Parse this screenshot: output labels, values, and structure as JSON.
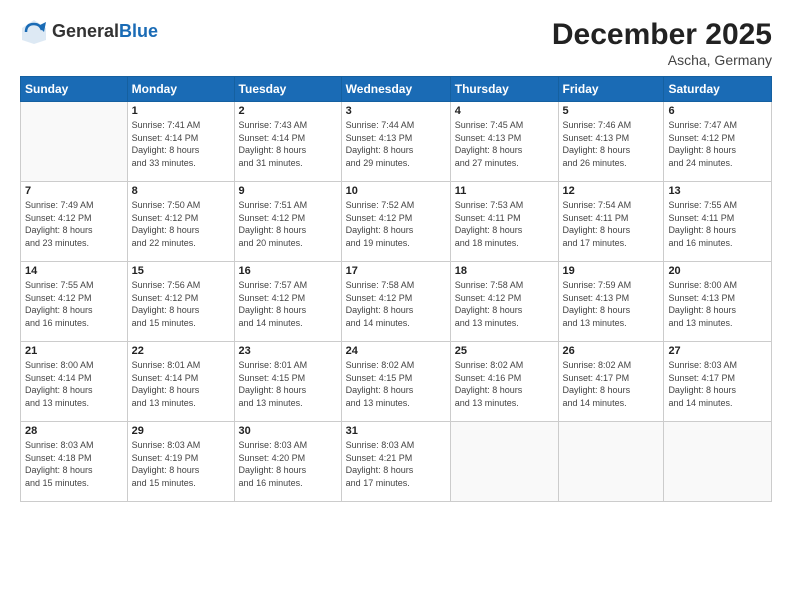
{
  "header": {
    "logo_line1": "General",
    "logo_line2": "Blue",
    "month": "December 2025",
    "location": "Ascha, Germany"
  },
  "days_of_week": [
    "Sunday",
    "Monday",
    "Tuesday",
    "Wednesday",
    "Thursday",
    "Friday",
    "Saturday"
  ],
  "weeks": [
    [
      {
        "day": "",
        "info": ""
      },
      {
        "day": "1",
        "info": "Sunrise: 7:41 AM\nSunset: 4:14 PM\nDaylight: 8 hours\nand 33 minutes."
      },
      {
        "day": "2",
        "info": "Sunrise: 7:43 AM\nSunset: 4:14 PM\nDaylight: 8 hours\nand 31 minutes."
      },
      {
        "day": "3",
        "info": "Sunrise: 7:44 AM\nSunset: 4:13 PM\nDaylight: 8 hours\nand 29 minutes."
      },
      {
        "day": "4",
        "info": "Sunrise: 7:45 AM\nSunset: 4:13 PM\nDaylight: 8 hours\nand 27 minutes."
      },
      {
        "day": "5",
        "info": "Sunrise: 7:46 AM\nSunset: 4:13 PM\nDaylight: 8 hours\nand 26 minutes."
      },
      {
        "day": "6",
        "info": "Sunrise: 7:47 AM\nSunset: 4:12 PM\nDaylight: 8 hours\nand 24 minutes."
      }
    ],
    [
      {
        "day": "7",
        "info": "Sunrise: 7:49 AM\nSunset: 4:12 PM\nDaylight: 8 hours\nand 23 minutes."
      },
      {
        "day": "8",
        "info": "Sunrise: 7:50 AM\nSunset: 4:12 PM\nDaylight: 8 hours\nand 22 minutes."
      },
      {
        "day": "9",
        "info": "Sunrise: 7:51 AM\nSunset: 4:12 PM\nDaylight: 8 hours\nand 20 minutes."
      },
      {
        "day": "10",
        "info": "Sunrise: 7:52 AM\nSunset: 4:12 PM\nDaylight: 8 hours\nand 19 minutes."
      },
      {
        "day": "11",
        "info": "Sunrise: 7:53 AM\nSunset: 4:11 PM\nDaylight: 8 hours\nand 18 minutes."
      },
      {
        "day": "12",
        "info": "Sunrise: 7:54 AM\nSunset: 4:11 PM\nDaylight: 8 hours\nand 17 minutes."
      },
      {
        "day": "13",
        "info": "Sunrise: 7:55 AM\nSunset: 4:11 PM\nDaylight: 8 hours\nand 16 minutes."
      }
    ],
    [
      {
        "day": "14",
        "info": "Sunrise: 7:55 AM\nSunset: 4:12 PM\nDaylight: 8 hours\nand 16 minutes."
      },
      {
        "day": "15",
        "info": "Sunrise: 7:56 AM\nSunset: 4:12 PM\nDaylight: 8 hours\nand 15 minutes."
      },
      {
        "day": "16",
        "info": "Sunrise: 7:57 AM\nSunset: 4:12 PM\nDaylight: 8 hours\nand 14 minutes."
      },
      {
        "day": "17",
        "info": "Sunrise: 7:58 AM\nSunset: 4:12 PM\nDaylight: 8 hours\nand 14 minutes."
      },
      {
        "day": "18",
        "info": "Sunrise: 7:58 AM\nSunset: 4:12 PM\nDaylight: 8 hours\nand 13 minutes."
      },
      {
        "day": "19",
        "info": "Sunrise: 7:59 AM\nSunset: 4:13 PM\nDaylight: 8 hours\nand 13 minutes."
      },
      {
        "day": "20",
        "info": "Sunrise: 8:00 AM\nSunset: 4:13 PM\nDaylight: 8 hours\nand 13 minutes."
      }
    ],
    [
      {
        "day": "21",
        "info": "Sunrise: 8:00 AM\nSunset: 4:14 PM\nDaylight: 8 hours\nand 13 minutes."
      },
      {
        "day": "22",
        "info": "Sunrise: 8:01 AM\nSunset: 4:14 PM\nDaylight: 8 hours\nand 13 minutes."
      },
      {
        "day": "23",
        "info": "Sunrise: 8:01 AM\nSunset: 4:15 PM\nDaylight: 8 hours\nand 13 minutes."
      },
      {
        "day": "24",
        "info": "Sunrise: 8:02 AM\nSunset: 4:15 PM\nDaylight: 8 hours\nand 13 minutes."
      },
      {
        "day": "25",
        "info": "Sunrise: 8:02 AM\nSunset: 4:16 PM\nDaylight: 8 hours\nand 13 minutes."
      },
      {
        "day": "26",
        "info": "Sunrise: 8:02 AM\nSunset: 4:17 PM\nDaylight: 8 hours\nand 14 minutes."
      },
      {
        "day": "27",
        "info": "Sunrise: 8:03 AM\nSunset: 4:17 PM\nDaylight: 8 hours\nand 14 minutes."
      }
    ],
    [
      {
        "day": "28",
        "info": "Sunrise: 8:03 AM\nSunset: 4:18 PM\nDaylight: 8 hours\nand 15 minutes."
      },
      {
        "day": "29",
        "info": "Sunrise: 8:03 AM\nSunset: 4:19 PM\nDaylight: 8 hours\nand 15 minutes."
      },
      {
        "day": "30",
        "info": "Sunrise: 8:03 AM\nSunset: 4:20 PM\nDaylight: 8 hours\nand 16 minutes."
      },
      {
        "day": "31",
        "info": "Sunrise: 8:03 AM\nSunset: 4:21 PM\nDaylight: 8 hours\nand 17 minutes."
      },
      {
        "day": "",
        "info": ""
      },
      {
        "day": "",
        "info": ""
      },
      {
        "day": "",
        "info": ""
      }
    ]
  ]
}
